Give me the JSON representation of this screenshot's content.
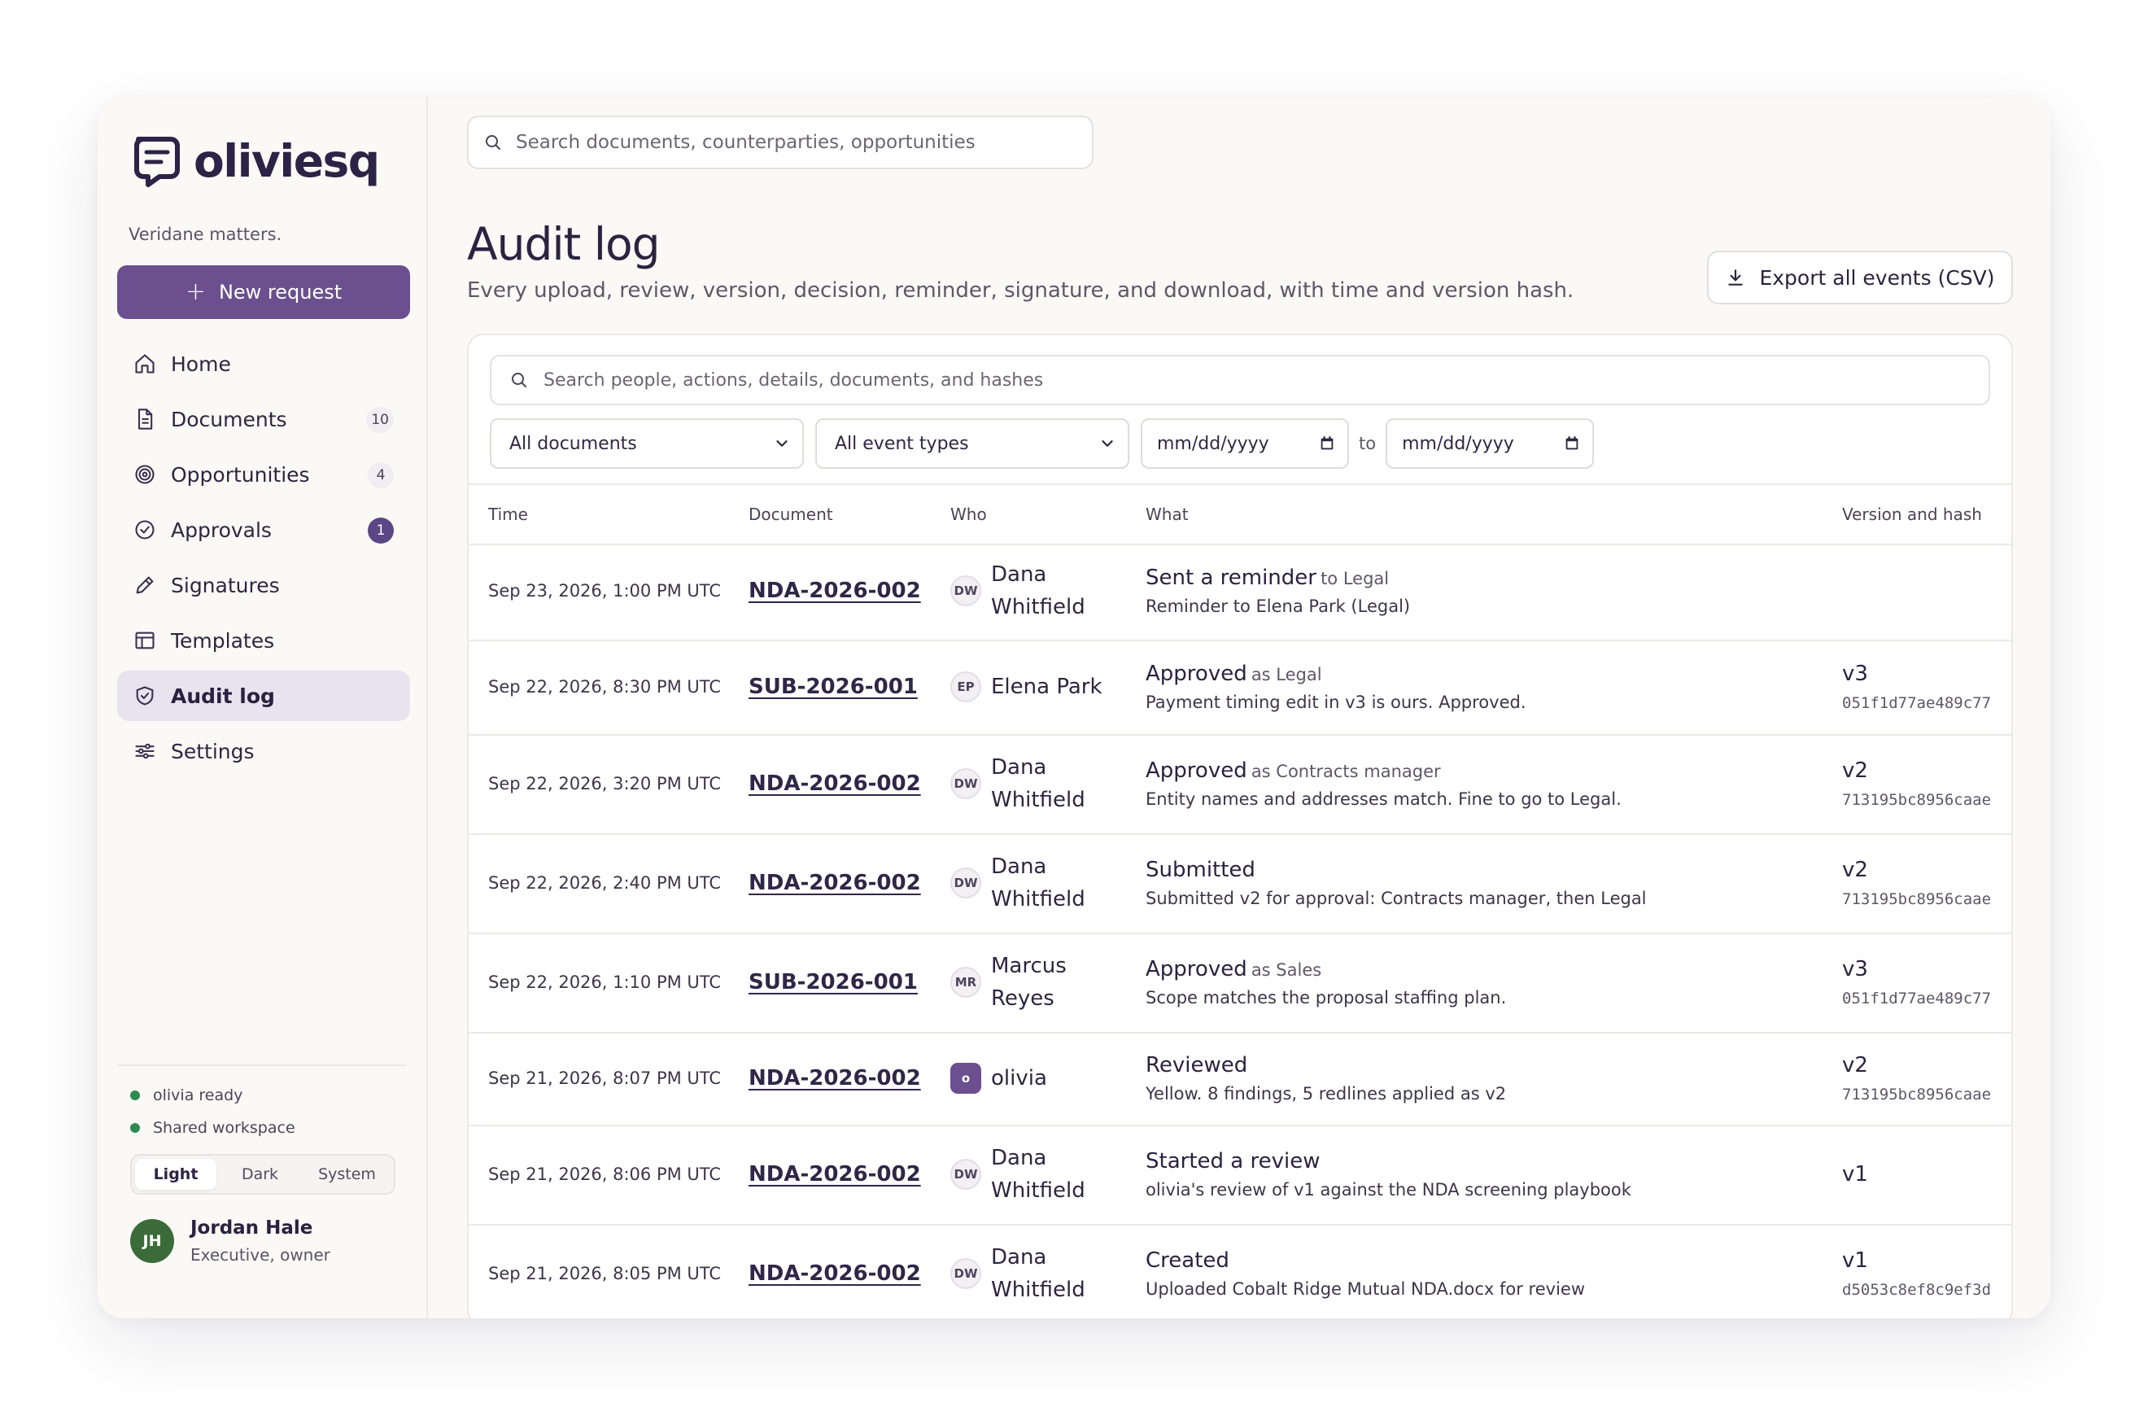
{
  "app": {
    "name": "oliviesq",
    "tagline": "Veridane matters."
  },
  "sidebar": {
    "new_request": "New request",
    "items": [
      {
        "label": "Home",
        "icon": "home-icon",
        "badge": ""
      },
      {
        "label": "Documents",
        "icon": "document-icon",
        "badge": "10"
      },
      {
        "label": "Opportunities",
        "icon": "target-icon",
        "badge": "4"
      },
      {
        "label": "Approvals",
        "icon": "check-circle-icon",
        "badge": "1"
      },
      {
        "label": "Signatures",
        "icon": "pen-icon",
        "badge": ""
      },
      {
        "label": "Templates",
        "icon": "layout-icon",
        "badge": ""
      },
      {
        "label": "Audit log",
        "icon": "shield-check-icon",
        "badge": "",
        "active": true
      },
      {
        "label": "Settings",
        "icon": "sliders-icon",
        "badge": ""
      }
    ],
    "status": [
      "olivia ready",
      "Shared workspace"
    ],
    "status_color": "#2f8a4f",
    "theme_options": [
      "Light",
      "Dark",
      "System"
    ],
    "theme_selected": "Light",
    "user": {
      "initials": "JH",
      "name": "Jordan Hale",
      "role": "Executive, owner"
    }
  },
  "header": {
    "search_placeholder": "Search documents, counterparties, opportunities",
    "title": "Audit log",
    "subtitle": "Every upload, review, version, decision, reminder, signature, and download, with time and version hash.",
    "export_label": "Export all events (CSV)"
  },
  "filters": {
    "search_placeholder": "Search people, actions, details, documents, and hashes",
    "document": "All documents",
    "event_type": "All event types",
    "date_from": "mm/dd/yyyy",
    "to_label": "to",
    "date_to": "mm/dd/yyyy"
  },
  "table": {
    "columns": [
      "Time",
      "Document",
      "Who",
      "What",
      "Version and hash"
    ],
    "rows": [
      {
        "time": "Sep 23, 2026, 1:00 PM UTC",
        "doc": "NDA-2026-002",
        "initials": "DW",
        "who_lines": [
          "Dana",
          "Whitfield"
        ],
        "action": "Sent a reminder",
        "role": "to Legal",
        "detail": "Reminder to Elena Park (Legal)",
        "version": "",
        "hash": ""
      },
      {
        "time": "Sep 22, 2026, 8:30 PM UTC",
        "doc": "SUB-2026-001",
        "initials": "EP",
        "who_lines": [
          "Elena Park"
        ],
        "action": "Approved",
        "role": "as Legal",
        "detail": "Payment timing edit in v3 is ours. Approved.",
        "version": "v3",
        "hash": "051f1d77ae489c77"
      },
      {
        "time": "Sep 22, 2026, 3:20 PM UTC",
        "doc": "NDA-2026-002",
        "initials": "DW",
        "who_lines": [
          "Dana",
          "Whitfield"
        ],
        "action": "Approved",
        "role": "as Contracts manager",
        "detail": "Entity names and addresses match. Fine to go to Legal.",
        "version": "v2",
        "hash": "713195bc8956caae"
      },
      {
        "time": "Sep 22, 2026, 2:40 PM UTC",
        "doc": "NDA-2026-002",
        "initials": "DW",
        "who_lines": [
          "Dana",
          "Whitfield"
        ],
        "action": "Submitted",
        "role": "",
        "detail": "Submitted v2 for approval: Contracts manager, then Legal",
        "version": "v2",
        "hash": "713195bc8956caae"
      },
      {
        "time": "Sep 22, 2026, 1:10 PM UTC",
        "doc": "SUB-2026-001",
        "initials": "MR",
        "who_lines": [
          "Marcus",
          "Reyes"
        ],
        "action": "Approved",
        "role": "as Sales",
        "detail": "Scope matches the proposal staffing plan.",
        "version": "v3",
        "hash": "051f1d77ae489c77"
      },
      {
        "time": "Sep 21, 2026, 8:07 PM UTC",
        "doc": "NDA-2026-002",
        "initials": "o",
        "who_lines": [
          "olivia"
        ],
        "action": "Reviewed",
        "role": "",
        "detail": "Yellow. 8 findings, 5 redlines applied as v2",
        "version": "v2",
        "hash": "713195bc8956caae"
      },
      {
        "time": "Sep 21, 2026, 8:06 PM UTC",
        "doc": "NDA-2026-002",
        "initials": "DW",
        "who_lines": [
          "Dana",
          "Whitfield"
        ],
        "action": "Started a review",
        "role": "",
        "detail": "olivia's review of v1 against the NDA screening playbook",
        "version": "v1",
        "hash": ""
      },
      {
        "time": "Sep 21, 2026, 8:05 PM UTC",
        "doc": "NDA-2026-002",
        "initials": "DW",
        "who_lines": [
          "Dana",
          "Whitfield"
        ],
        "action": "Created",
        "role": "",
        "detail": "Uploaded Cobalt Ridge Mutual NDA.docx for review",
        "version": "v1",
        "hash": "d5053c8ef8c9ef3d"
      }
    ]
  },
  "colors": {
    "accent": "#6b4f8f",
    "active_bg": "#e9e3ef",
    "badge_solid": "#5d4685"
  }
}
